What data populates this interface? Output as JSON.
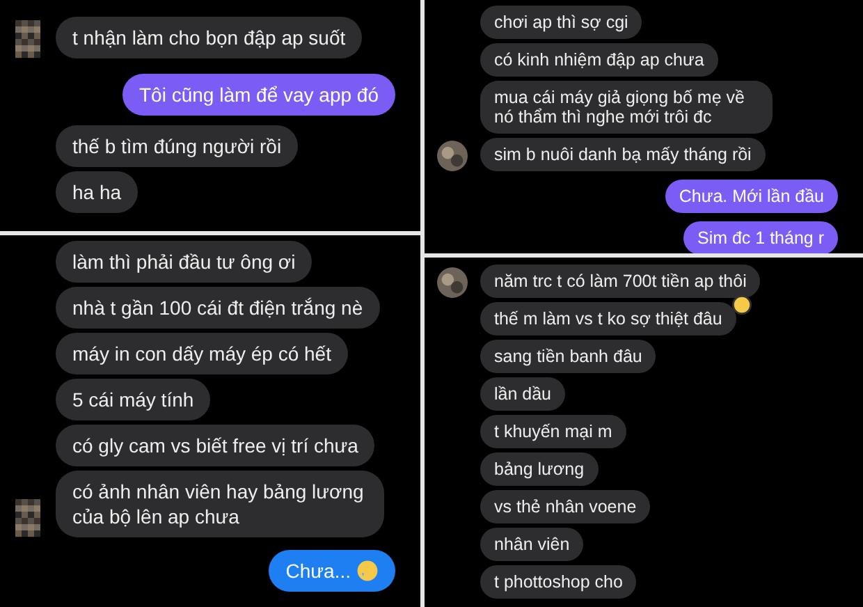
{
  "panels": [
    {
      "messages": [
        {
          "text": "t nhận làm cho bọn đập ap suốt",
          "kind": "incoming",
          "avatar": true
        },
        {
          "text": "Tôi cũng làm để vay app đó",
          "kind": "outgoing",
          "color": "#7b5cf5"
        },
        {
          "text": "thế b tìm đúng người rồi",
          "kind": "incoming",
          "avatar": false
        },
        {
          "text": "ha ha",
          "kind": "incoming",
          "avatar": false
        }
      ]
    },
    {
      "messages": [
        {
          "text": "chơi ap thì sợ cgi",
          "kind": "incoming",
          "avatar": false
        },
        {
          "text": "có kinh nhiệm đập ap chưa",
          "kind": "incoming",
          "avatar": false
        },
        {
          "text": "mua cái máy giả giọng bố mẹ về nó thẩm thì nghe mới trôi đc",
          "kind": "incoming",
          "avatar": false
        },
        {
          "text": "sim b nuôi danh bạ mấy tháng rồi",
          "kind": "incoming",
          "avatar": true
        },
        {
          "text": "Chưa. Mới lần đầu",
          "kind": "outgoing",
          "color": "#7b5cf5"
        },
        {
          "text": "Sim đc 1 tháng r",
          "kind": "outgoing",
          "color": "#7b5cf5"
        }
      ]
    },
    {
      "messages": [
        {
          "text": "làm thì phải đầu tư ông ơi",
          "kind": "incoming",
          "avatar": false
        },
        {
          "text": "nhà t gần 100 cái đt điện trắng nè",
          "kind": "incoming",
          "avatar": false
        },
        {
          "text": "máy in con dấy máy ép có hết",
          "kind": "incoming",
          "avatar": false
        },
        {
          "text": "5 cái máy tính",
          "kind": "incoming",
          "avatar": false
        },
        {
          "text": "có gly cam vs biết free vị trí chưa",
          "kind": "incoming",
          "avatar": false
        },
        {
          "text": "có ảnh nhân viên hay bảng lương của bộ lên ap chưa",
          "kind": "incoming",
          "avatar": true
        },
        {
          "text": "Chưa...",
          "kind": "outgoing",
          "color": "#1d7ff2",
          "emoji": true
        }
      ]
    },
    {
      "messages": [
        {
          "text": "năm trc t có làm 700t tiền ap thôi",
          "kind": "incoming",
          "avatar": true,
          "reaction": true
        },
        {
          "text": "thế m làm vs t ko sợ thiệt đâu",
          "kind": "incoming",
          "avatar": false
        },
        {
          "text": "sang tiền banh đâu",
          "kind": "incoming",
          "avatar": false
        },
        {
          "text": "lần dầu",
          "kind": "incoming",
          "avatar": false
        },
        {
          "text": "t khuyến mại m",
          "kind": "incoming",
          "avatar": false
        },
        {
          "text": "bảng lương",
          "kind": "incoming",
          "avatar": false
        },
        {
          "text": "vs thẻ nhân voene",
          "kind": "incoming",
          "avatar": false
        },
        {
          "text": "nhân viên",
          "kind": "incoming",
          "avatar": false
        },
        {
          "text": "t phottoshop cho",
          "kind": "incoming",
          "avatar": false
        }
      ]
    }
  ]
}
